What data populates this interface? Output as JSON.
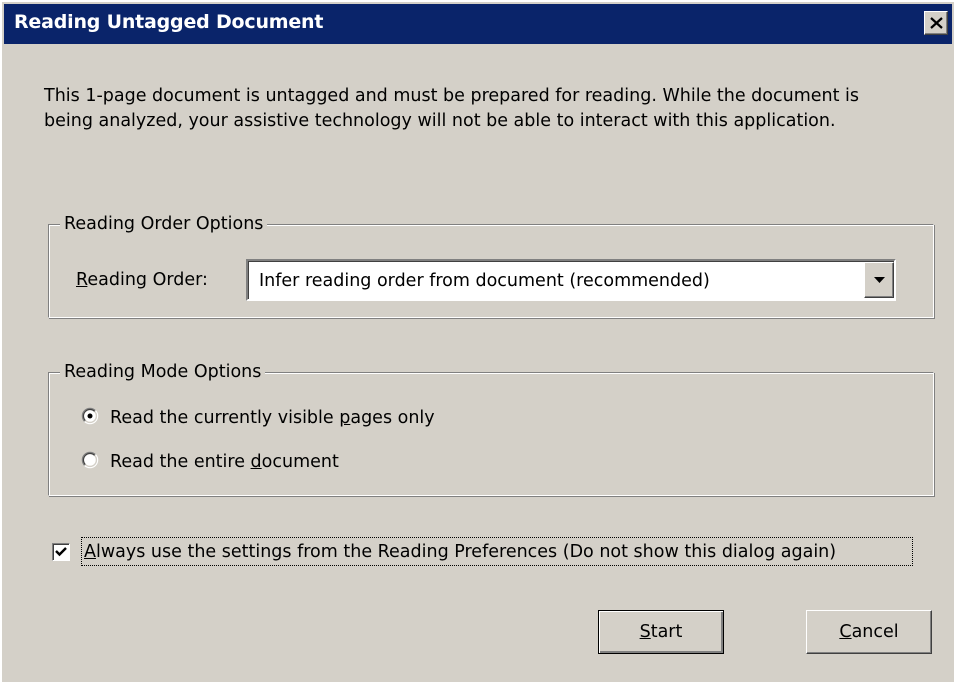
{
  "window": {
    "title": "Reading Untagged Document"
  },
  "message": "This 1-page document is untagged and must be prepared for reading. While the document is being analyzed, your assistive technology will not be able to interact with this application.",
  "reading_order_group": {
    "legend": "Reading Order Options",
    "label_mnemonic": "R",
    "label_rest": "eading Order:",
    "selected_value": "Infer reading order from document (recommended)"
  },
  "reading_mode_group": {
    "legend": "Reading Mode Options",
    "options": [
      {
        "pre": "Read the currently visible ",
        "mnemonic": "p",
        "post": "ages only",
        "selected": true
      },
      {
        "pre": "Read the entire ",
        "mnemonic": "d",
        "post": "ocument",
        "selected": false
      }
    ]
  },
  "always_use": {
    "mnemonic": "A",
    "rest": "lways use the settings from the Reading Preferences (Do not show this dialog again)",
    "checked": true
  },
  "buttons": {
    "start_mnemonic": "S",
    "start_rest": "tart",
    "cancel_mnemonic": "C",
    "cancel_rest": "ancel"
  }
}
